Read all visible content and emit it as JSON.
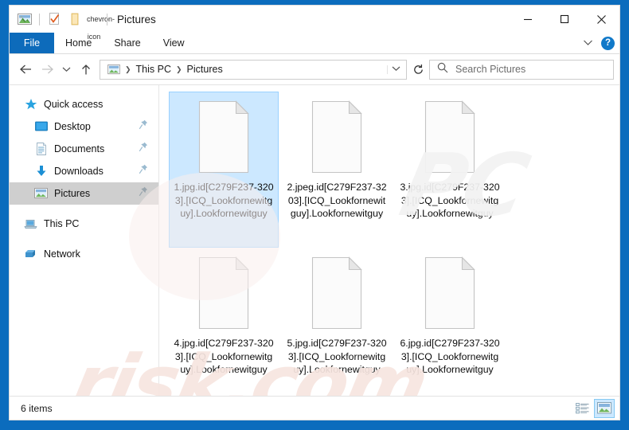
{
  "window": {
    "title": "Pictures",
    "quick_access_icons": [
      "pictures-icon",
      "properties-icon",
      "new-folder-icon",
      "customize-chevron-icon"
    ],
    "controls": {
      "minimize": "–",
      "maximize": "□",
      "close": "✕"
    }
  },
  "ribbon": {
    "tabs": [
      {
        "label": "File",
        "active": true
      },
      {
        "label": "Home",
        "active": false
      },
      {
        "label": "Share",
        "active": false
      },
      {
        "label": "View",
        "active": false
      }
    ],
    "expand_icon": "∨",
    "help_label": "?"
  },
  "navbar": {
    "back_icon": "←",
    "forward_icon": "→",
    "recent_icon": "∨",
    "up_icon": "↑",
    "breadcrumbs": [
      "This PC",
      "Pictures"
    ],
    "breadcrumb_separator": "❯",
    "dropdown_icon": "∨",
    "refresh_icon": "↻"
  },
  "search": {
    "placeholder": "Search Pictures",
    "value": "",
    "icon": "search-icon"
  },
  "sidebar": {
    "items": [
      {
        "label": "Quick access",
        "icon": "star-icon",
        "indent": false,
        "pinned": false,
        "selected": false
      },
      {
        "label": "Desktop",
        "icon": "desktop-icon",
        "indent": true,
        "pinned": true,
        "selected": false
      },
      {
        "label": "Documents",
        "icon": "documents-icon",
        "indent": true,
        "pinned": true,
        "selected": false
      },
      {
        "label": "Downloads",
        "icon": "downloads-icon",
        "indent": true,
        "pinned": true,
        "selected": false
      },
      {
        "label": "Pictures",
        "icon": "pictures-icon",
        "indent": true,
        "pinned": true,
        "selected": true
      },
      {
        "label": "This PC",
        "icon": "this-pc-icon",
        "indent": false,
        "pinned": false,
        "selected": false
      },
      {
        "label": "Network",
        "icon": "network-icon",
        "indent": false,
        "pinned": false,
        "selected": false
      }
    ]
  },
  "files": [
    {
      "name": "1.jpg.id[C279F237-3203].[ICQ_Lookfornewitguy].Lookfornewitguy",
      "icon": "blank-file-icon",
      "selected": true
    },
    {
      "name": "2.jpeg.id[C279F237-3203].[ICQ_Lookfornewitguy].Lookfornewitguy",
      "icon": "blank-file-icon",
      "selected": false
    },
    {
      "name": "3.jpg.id[C279F237-3203].[ICQ_Lookfornewitguy].Lookfornewitguy",
      "icon": "blank-file-icon",
      "selected": false
    },
    {
      "name": "4.jpg.id[C279F237-3203].[ICQ_Lookfornewitguy].Lookfornewitguy",
      "icon": "blank-file-icon",
      "selected": false
    },
    {
      "name": "5.jpg.id[C279F237-3203].[ICQ_Lookfornewitguy].Lookfornewitguy",
      "icon": "blank-file-icon",
      "selected": false
    },
    {
      "name": "6.jpg.id[C279F237-3203].[ICQ_Lookfornewitguy].Lookfornewitguy",
      "icon": "blank-file-icon",
      "selected": false
    }
  ],
  "statusbar": {
    "item_count": "6 items",
    "views": [
      {
        "name": "details-view",
        "active": false
      },
      {
        "name": "large-icons-view",
        "active": true
      }
    ]
  },
  "watermark": {
    "text_top": "PC",
    "text_bottom": "risk.com"
  },
  "colors": {
    "desktop_blue": "#0b6cbd",
    "ribbon_file_blue": "#0d6bbb",
    "selection_blue": "#cce8ff",
    "selection_border": "#99d1ff",
    "sidebar_selected": "#cfcfcf",
    "help_blue": "#1179c9"
  }
}
